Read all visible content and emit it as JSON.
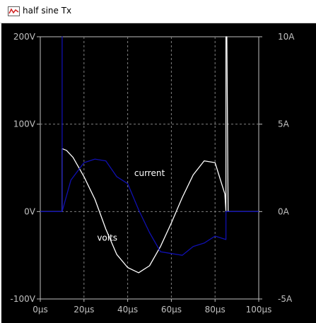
{
  "window": {
    "title": "half sine Tx",
    "icon": "waveform-icon"
  },
  "colors": {
    "background": "#000000",
    "grid": "#808080",
    "axis": "#c0c0c0",
    "volts_trace": "#ffffff",
    "current_trace": "#1010b0"
  },
  "chart_data": {
    "type": "line",
    "title": "",
    "xlabel": "",
    "ylabel": "",
    "x_unit": "µs",
    "xlim": [
      0,
      100
    ],
    "ylim_left": [
      -100,
      200
    ],
    "ylim_right": [
      -5,
      10
    ],
    "x_ticks": [
      "0µs",
      "20µs",
      "40µs",
      "60µs",
      "80µs",
      "100µs"
    ],
    "y_ticks_left": [
      "200V",
      "100V",
      "0V",
      "-100V"
    ],
    "y_ticks_right": [
      "10A",
      "5A",
      "0A",
      "-5A"
    ],
    "grid": true,
    "annotations": [
      {
        "text": "current",
        "x": 43,
        "y": 44
      },
      {
        "text": "volts",
        "x": 26,
        "y": -30
      }
    ],
    "series": [
      {
        "name": "volts",
        "axis": "left",
        "color": "#ffffff",
        "x": [
          0,
          10,
          10,
          12,
          15,
          20,
          25,
          30,
          35,
          40,
          45,
          50,
          55,
          60,
          65,
          70,
          75,
          80,
          84.5,
          85,
          85,
          85.2,
          85.4,
          86,
          100
        ],
        "y": [
          0,
          0,
          72,
          70,
          62,
          40,
          14,
          -20,
          -49,
          -64,
          -70,
          -62,
          -40,
          -13,
          16,
          42,
          58,
          56,
          20,
          0,
          200,
          200,
          200,
          0,
          0
        ]
      },
      {
        "name": "current",
        "axis": "right",
        "color": "#1010b0",
        "x": [
          0,
          10,
          10,
          10,
          14,
          20,
          25,
          30,
          35,
          40,
          45,
          50,
          55,
          60,
          65,
          70,
          75,
          80,
          85,
          85,
          86,
          100
        ],
        "y": [
          0,
          0,
          10,
          0,
          1.8,
          2.8,
          3.0,
          2.9,
          2.0,
          1.6,
          0.1,
          -1.2,
          -2.3,
          -2.4,
          -2.5,
          -2.0,
          -1.8,
          -1.4,
          -1.6,
          0,
          0,
          0
        ]
      }
    ]
  }
}
